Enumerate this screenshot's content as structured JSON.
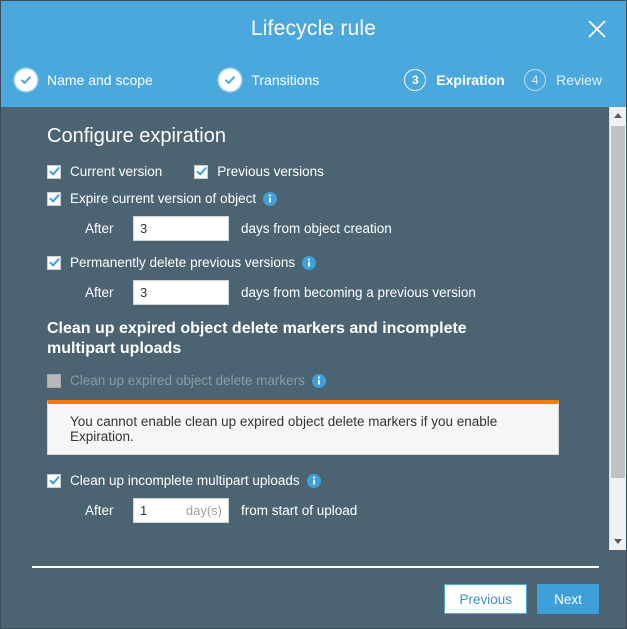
{
  "dialog": {
    "title": "Lifecycle rule",
    "close_icon": "close-icon"
  },
  "steps": [
    {
      "label": "Name and scope",
      "state": "done",
      "badge": "check"
    },
    {
      "label": "Transitions",
      "state": "done",
      "badge": "check"
    },
    {
      "label": "Expiration",
      "state": "active",
      "badge": "3"
    },
    {
      "label": "Review",
      "state": "upcoming",
      "badge": "4"
    }
  ],
  "main": {
    "section_title": "Configure expiration",
    "version_scope": [
      {
        "label": "Current version",
        "checked": true
      },
      {
        "label": "Previous versions",
        "checked": true
      }
    ],
    "expire_current": {
      "label": "Expire current version of object",
      "checked": true,
      "after_label": "After",
      "value": "3",
      "suffix": "days from object creation"
    },
    "delete_previous": {
      "label": "Permanently delete previous versions",
      "checked": true,
      "after_label": "After",
      "value": "3",
      "suffix": "days from becoming a previous version"
    },
    "cleanup_heading": "Clean up expired object delete markers and incomplete multipart uploads",
    "cleanup_markers": {
      "label": "Clean up expired object delete markers",
      "checked": false,
      "disabled": true
    },
    "alert": {
      "text": "You cannot enable clean up expired object delete markers if you enable Expiration.",
      "accent_color": "#ef7c00"
    },
    "cleanup_multipart": {
      "label": "Clean up incomplete multipart uploads",
      "checked": true,
      "after_label": "After",
      "value": "1",
      "field_suffix": "day(s)",
      "suffix": "from start of upload"
    }
  },
  "footer": {
    "previous_label": "Previous",
    "next_label": "Next"
  },
  "colors": {
    "header_blue": "#4aa8dd",
    "body_slate": "#4c6372",
    "accent_orange": "#ef7c00",
    "primary_button": "#3f9fd8"
  }
}
